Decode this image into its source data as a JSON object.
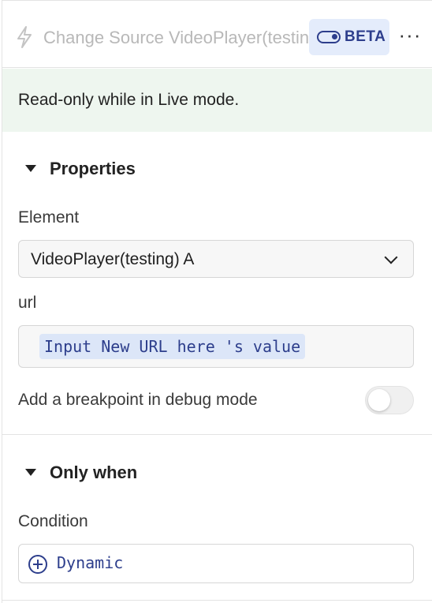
{
  "header": {
    "title": "Change Source VideoPlayer(testing) A",
    "beta_label": "BETA",
    "more_label": "···",
    "icon": "lightning-bolt-icon"
  },
  "notice": {
    "text": "Read-only while in Live mode."
  },
  "properties": {
    "section_label": "Properties",
    "element_label": "Element",
    "element_value": "VideoPlayer(testing) A",
    "url_label": "url",
    "url_chip": "Input New URL here 's value",
    "breakpoint_label": "Add a breakpoint in debug mode",
    "breakpoint_enabled": false
  },
  "only_when": {
    "section_label": "Only when",
    "condition_label": "Condition",
    "dynamic_label": "Dynamic"
  },
  "colors": {
    "accent": "#2d3e8c",
    "notice_bg": "#eef6ef",
    "chip_bg": "#dce6f8"
  }
}
